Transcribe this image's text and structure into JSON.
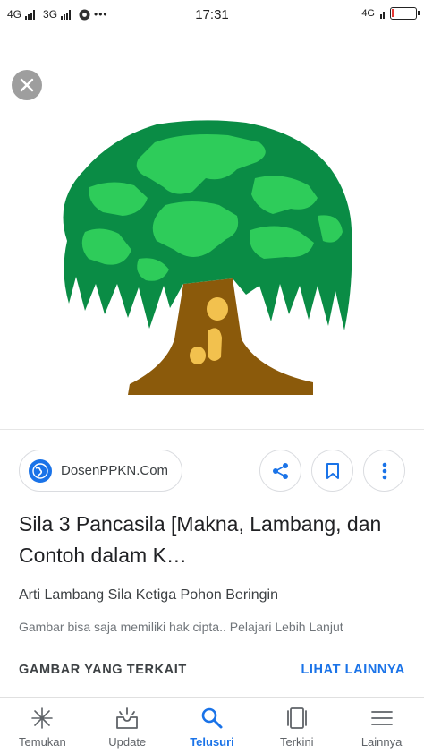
{
  "status_bar": {
    "network_1": "4G",
    "network_2": "3G",
    "more_dots": "•••",
    "time": "17:31",
    "network_right": "4G"
  },
  "source": {
    "name": "DosenPPKN.Com"
  },
  "result": {
    "title": "Sila 3 Pancasila [Makna, Lambang, dan Contoh dalam K…",
    "subtitle": "Arti Lambang Sila Ketiga Pohon Beringin",
    "copyright_note": "Gambar bisa saja memiliki hak cipta.. Pelajari Lebih Lanjut"
  },
  "related": {
    "label": "GAMBAR YANG TERKAIT",
    "more_label": "LIHAT LAINNYA"
  },
  "bottom_nav": {
    "items": [
      {
        "label": "Temukan",
        "icon": "asterisk-icon"
      },
      {
        "label": "Update",
        "icon": "update-inbox-icon"
      },
      {
        "label": "Telusuri",
        "icon": "search-icon",
        "active": true
      },
      {
        "label": "Terkini",
        "icon": "recent-cards-icon"
      },
      {
        "label": "Lainnya",
        "icon": "menu-icon"
      }
    ]
  },
  "colors": {
    "accent": "#1a73e8",
    "tree_dark_green": "#0a8c45",
    "tree_light_green": "#2ecc5a",
    "trunk_brown": "#8b5a0b",
    "trunk_yellow": "#f2c14e"
  }
}
